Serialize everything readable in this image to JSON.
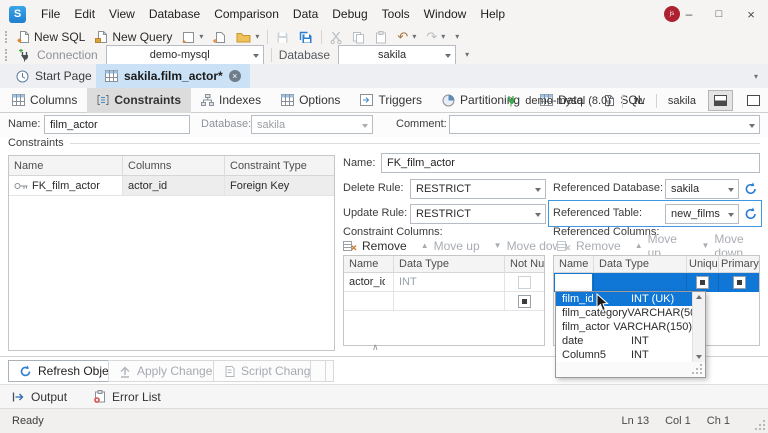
{
  "colors": {
    "accent_blue": "#1177d7",
    "active_tab_blue": "#cbe1f5",
    "selected_tab_gray": "#dcdcdc",
    "focus_border": "#3f97e0"
  },
  "icons": {
    "chevron_down": "▾",
    "triangle_up": "▲",
    "triangle_down": "▼",
    "minimize": "–",
    "maximize": "□",
    "close": "×",
    "close_tab": "×",
    "undo": "↶",
    "redo": "↷",
    "collapse_up": "∧",
    "logo": "S"
  },
  "titlebar": {
    "menus": [
      "File",
      "Edit",
      "View",
      "Database",
      "Comparison",
      "Data",
      "Debug",
      "Tools",
      "Window",
      "Help"
    ],
    "avatar_initials": "js"
  },
  "toolbar": {
    "new_sql": "New SQL",
    "new_query": "New Query"
  },
  "connection_bar": {
    "connection_label": "Connection",
    "connection_value": "demo-mysql",
    "database_label": "Database",
    "database_value": "sakila"
  },
  "doc_tabs": {
    "start_page": "Start Page",
    "active_tab": "sakila.film_actor*"
  },
  "object_tabs": [
    "Columns",
    "Constraints",
    "Indexes",
    "Options",
    "Triggers",
    "Partitioning",
    "Data",
    "SQL"
  ],
  "connection_info": {
    "server": "demo-mysql (8.0)",
    "schema": "tw",
    "database": "sakila"
  },
  "editor_form": {
    "name_label": "Name:",
    "name_value": "film_actor",
    "database_label": "Database:",
    "database_value": "sakila",
    "comment_label": "Comment:",
    "comment_value": ""
  },
  "constraints_group": {
    "title": "Constraints",
    "headers": [
      "Name",
      "Columns",
      "Constraint Type"
    ],
    "rows": [
      {
        "name": "FK_film_actor",
        "columns": "actor_id",
        "type": "Foreign Key"
      }
    ]
  },
  "detail": {
    "name_label": "Name:",
    "name_value": "FK_film_actor",
    "delete_rule_label": "Delete Rule:",
    "delete_rule_value": "RESTRICT",
    "update_rule_label": "Update Rule:",
    "update_rule_value": "RESTRICT",
    "ref_db_label": "Referenced Database:",
    "ref_db_value": "sakila",
    "ref_table_label": "Referenced Table:",
    "ref_table_value": "new_films"
  },
  "constraint_columns": {
    "title": "Constraint Columns:",
    "remove": "Remove",
    "move_up": "Move up",
    "move_down": "Move down",
    "headers": [
      "Name",
      "Data Type",
      "Not Null"
    ],
    "row_name": "actor_id",
    "row_type": "INT"
  },
  "referenced_columns": {
    "title": "Referenced Columns:",
    "remove": "Remove",
    "move_up": "Move up",
    "move_down": "Move down",
    "headers": [
      "Name",
      "Data Type",
      "Unique",
      "Primary"
    ]
  },
  "dropdown": {
    "items": [
      {
        "name": "film_id",
        "type": "INT (UK)"
      },
      {
        "name": "film_category",
        "type": "VARCHAR(50)"
      },
      {
        "name": "film_actor",
        "type": "VARCHAR(150)"
      },
      {
        "name": "date",
        "type": "INT"
      },
      {
        "name": "Column5",
        "type": "INT"
      }
    ]
  },
  "footer": {
    "refresh": "Refresh Object",
    "apply": "Apply Changes",
    "script": "Script Changes"
  },
  "bottom_tabs": {
    "output": "Output",
    "error_list": "Error List"
  },
  "statusbar": {
    "state": "Ready",
    "line": "Ln 13",
    "col": "Col 1",
    "ch": "Ch 1"
  }
}
